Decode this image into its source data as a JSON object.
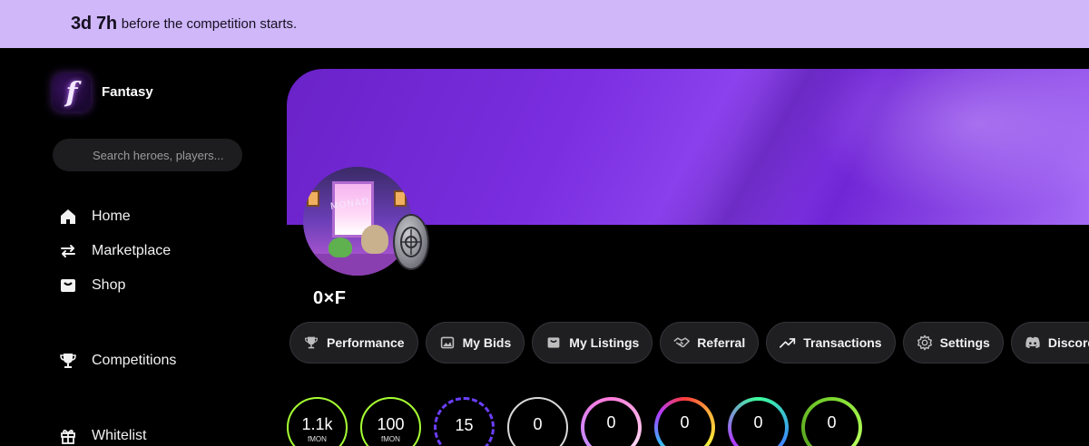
{
  "countdown": {
    "time": "3d 7h",
    "message": "before the competition starts."
  },
  "brand": {
    "name": "Fantasy",
    "logo_letter": "f"
  },
  "search": {
    "placeholder": "Search heroes, players..."
  },
  "nav": {
    "home": "Home",
    "marketplace": "Marketplace",
    "shop": "Shop",
    "competitions": "Competitions",
    "whitelist": "Whitelist"
  },
  "profile": {
    "username": "0×F",
    "avatar_sign": "MONAD"
  },
  "tabs": {
    "performance": "Performance",
    "my_bids": "My Bids",
    "my_listings": "My Listings",
    "referral": "Referral",
    "transactions": "Transactions",
    "settings": "Settings",
    "discord": "Discord"
  },
  "stats": [
    {
      "value": "1.1k",
      "unit": "fMON",
      "ring": "#a6ff33"
    },
    {
      "value": "100",
      "unit": "fMON",
      "ring": "#a6ff33"
    },
    {
      "value": "15",
      "unit": "",
      "ring": "#6b3fff"
    },
    {
      "value": "0",
      "unit": "",
      "ring": "#d9d9d9"
    },
    {
      "value": "0",
      "unit": "",
      "ring": "gradient-pink"
    },
    {
      "value": "0",
      "unit": "",
      "ring": "gradient-rainbow"
    },
    {
      "value": "0",
      "unit": "",
      "ring": "gradient-green-blue"
    },
    {
      "value": "0",
      "unit": "",
      "ring": "#7bd62e"
    }
  ],
  "colors": {
    "banner": "#cfb7f9",
    "accent": "#7a2ee0",
    "background": "#000000"
  }
}
